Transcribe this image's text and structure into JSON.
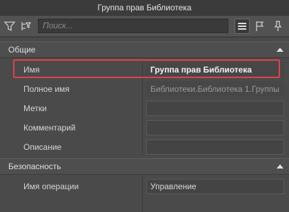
{
  "window": {
    "title": "Группа прав Библиотека"
  },
  "toolbar": {
    "search_placeholder": "Поиск...",
    "icons": [
      "filter-icon",
      "tree-filter-icon",
      "list-view-icon",
      "flag-icon",
      "pin-icon"
    ]
  },
  "sections": [
    {
      "label": "Общие",
      "rows": [
        {
          "name": "Имя",
          "value": "Группа прав Библиотека"
        },
        {
          "name": "Полное имя",
          "value": "Библиотеки.Библиотека 1.Группы"
        },
        {
          "name": "Метки",
          "value": ""
        },
        {
          "name": "Комментарий",
          "value": ""
        },
        {
          "name": "Описание",
          "value": ""
        }
      ]
    },
    {
      "label": "Безопасность",
      "rows": [
        {
          "name": "Имя операции",
          "value": "Управление"
        }
      ]
    }
  ],
  "colors": {
    "highlight": "#e0434a",
    "background": "#4a4a4a"
  }
}
